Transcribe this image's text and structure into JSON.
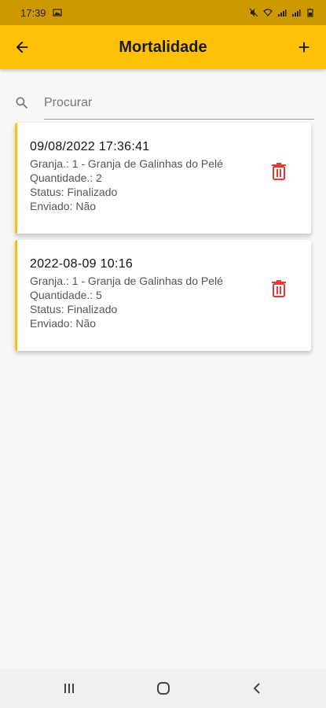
{
  "status_bar": {
    "time": "17:39"
  },
  "app_bar": {
    "title": "Mortalidade"
  },
  "search": {
    "placeholder": "Procurar"
  },
  "records": [
    {
      "date": "09/08/2022 17:36:41",
      "granja": "Granja.: 1 - Granja de Galinhas do Pelé",
      "quantidade": "Quantidade.: 2",
      "status": "Status: Finalizado",
      "enviado": "Enviado: Não"
    },
    {
      "date": "2022-08-09 10:16",
      "granja": "Granja.: 1 - Granja de Galinhas do Pelé",
      "quantidade": "Quantidade.: 5",
      "status": "Status: Finalizado",
      "enviado": "Enviado: Não"
    }
  ],
  "colors": {
    "accent": "#ffc107",
    "status_bar": "#cc9900",
    "delete": "#e53935"
  },
  "icons": [
    "back-arrow-icon",
    "add-icon",
    "search-icon",
    "delete-icon",
    "recents-icon",
    "home-icon",
    "nav-back-icon"
  ]
}
